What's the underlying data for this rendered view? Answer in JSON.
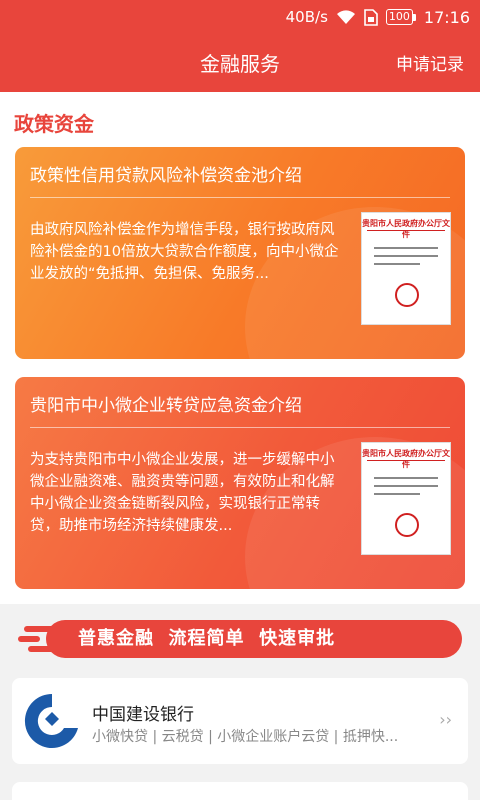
{
  "status": {
    "speed": "40B/s",
    "battery": "100",
    "time": "17:16"
  },
  "header": {
    "title": "金融服务",
    "records_label": "申请记录"
  },
  "section": {
    "title": "政策资金"
  },
  "cards": [
    {
      "title": "政策性信用贷款风险补偿资金池介绍",
      "desc": "由政府风险补偿金作为增信手段，银行按政府风险补偿金的10倍放大贷款合作额度，向中小微企业发放的“免抵押、免担保、免服务...",
      "doc_header": "贵阳市人民政府办公厅文件"
    },
    {
      "title": "贵阳市中小微企业转贷应急资金介绍",
      "desc": "为支持贵阳市中小微企业发展，进一步缓解中小微企业融资难、融资贵等问题，有效防止和化解中小微企业资金链断裂风险，实现银行正常转贷，助推市场经济持续健康发...",
      "doc_header": "贵阳市人民政府办公厅文件"
    }
  ],
  "banner": {
    "text": "普惠金融  流程简单  快速审批"
  },
  "bank": {
    "name": "中国建设银行",
    "tags": "小微快贷 | 云税贷 | 小微企业账户云贷 | 抵押快...",
    "arrow": "››"
  },
  "colors": {
    "brand": "#e8453c",
    "card1": "#f87a28",
    "card2": "#f25a3a"
  }
}
